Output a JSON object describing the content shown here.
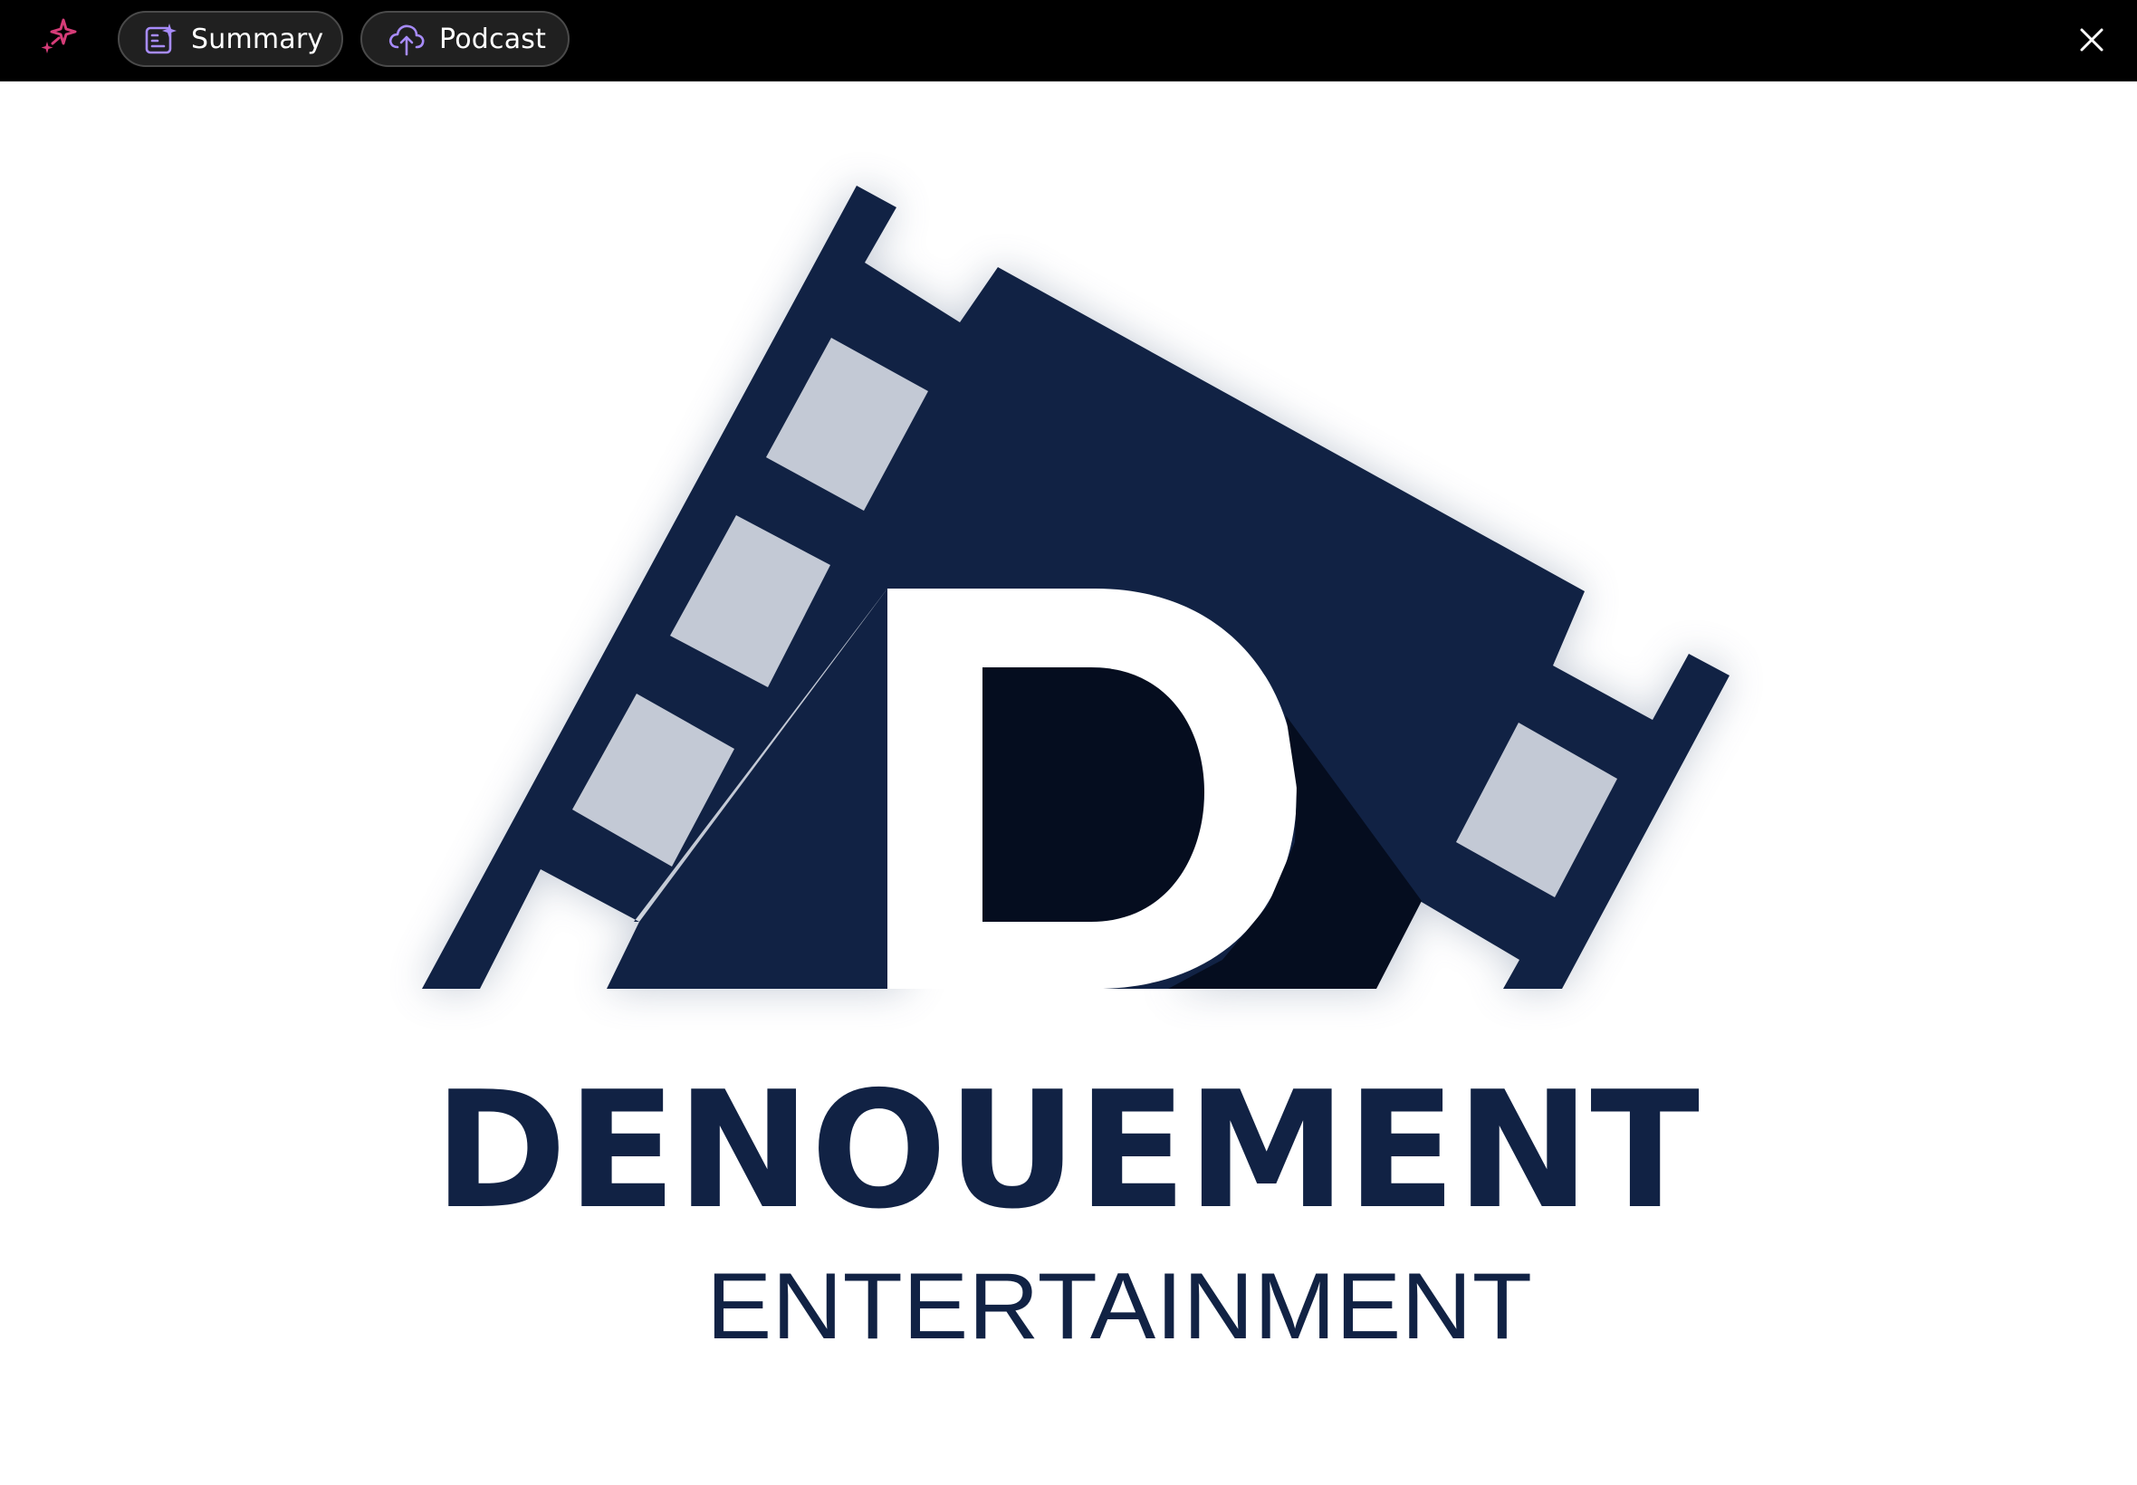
{
  "toolbar": {
    "ai_icon": "sparkle-ai-icon",
    "summary_label": "Summary",
    "summary_icon": "summary-document-icon",
    "podcast_label": "Podcast",
    "podcast_icon": "cloud-upload-icon",
    "close_icon": "close-icon"
  },
  "image": {
    "logo_text": "DENOUEMENT",
    "logo_subtext": "ENTERTAINMENT"
  },
  "colors": {
    "toolbar_bg": "#000000",
    "pill_bg": "#202020",
    "pill_border": "#4a4a4a",
    "icon_accent": "#a78bfa",
    "sparkle_accent": "#e0457b",
    "logo_navy": "#112244",
    "logo_dark": "#050d1f",
    "canvas_bg": "#ffffff"
  }
}
